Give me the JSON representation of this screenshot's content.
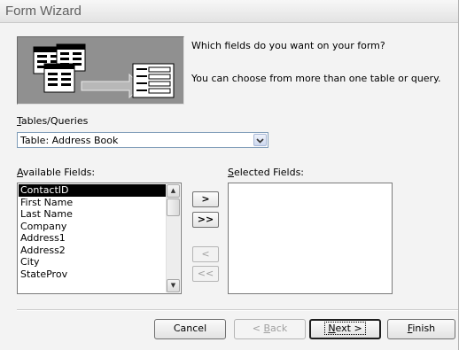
{
  "window": {
    "title": "Form Wizard"
  },
  "prompt": {
    "question": "Which fields do you want on your form?",
    "hint": "You can choose from more than one table or query."
  },
  "tables_queries": {
    "label_accel": "T",
    "label_rest": "ables/Queries",
    "selected": "Table: Address Book",
    "arrow_icon": "chevron-down-icon"
  },
  "available": {
    "label_accel": "A",
    "label_rest": "vailable Fields:",
    "items": [
      {
        "label": "ContactID",
        "selected": true
      },
      {
        "label": "First Name",
        "selected": false
      },
      {
        "label": "Last Name",
        "selected": false
      },
      {
        "label": "Company",
        "selected": false
      },
      {
        "label": "Address1",
        "selected": false
      },
      {
        "label": "Address2",
        "selected": false
      },
      {
        "label": "City",
        "selected": false
      },
      {
        "label": "StateProv",
        "selected": false
      }
    ],
    "scroll_up_glyph": "▲",
    "scroll_down_glyph": "▼"
  },
  "selected_fields": {
    "label_accel": "S",
    "label_rest": "elected Fields:",
    "items": []
  },
  "move_buttons": {
    "add_one": ">",
    "add_all": ">>",
    "remove_one": "<",
    "remove_all": "<<"
  },
  "footer": {
    "cancel": "Cancel",
    "back_prefix": "< ",
    "back_accel": "B",
    "back_rest": "ack",
    "next_accel": "N",
    "next_rest": "ext >",
    "finish_accel": "F",
    "finish_rest": "inish"
  }
}
